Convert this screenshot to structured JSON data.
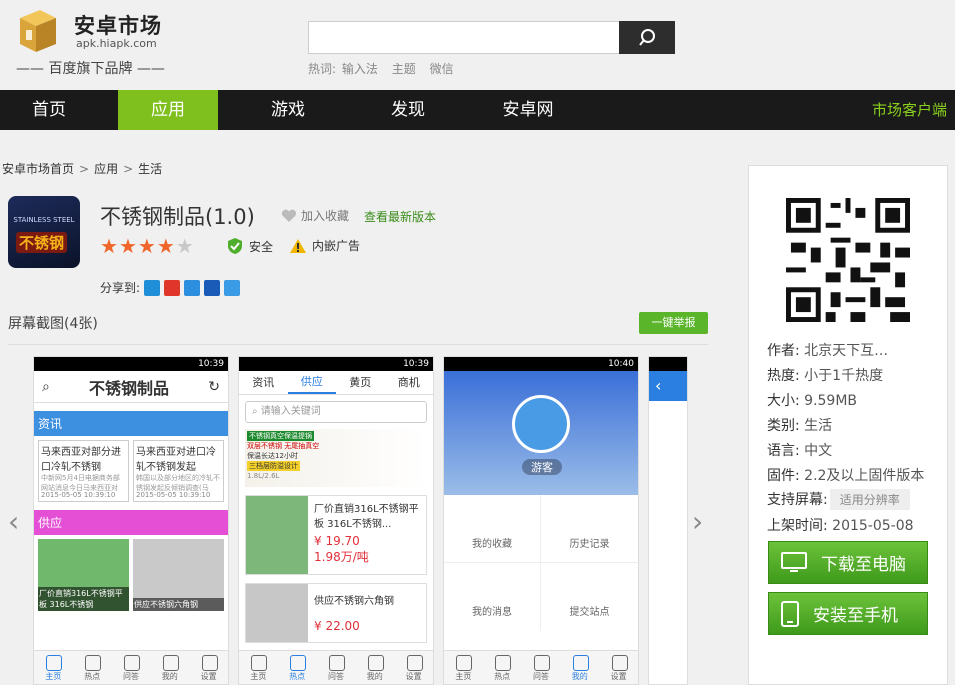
{
  "header": {
    "logo_title": "安卓市场",
    "logo_url": "apk.hiapk.com",
    "logo_sub": "—— 百度旗下品牌 ——",
    "hot_label": "热词:",
    "hot_words": [
      "输入法",
      "主题",
      "微信"
    ]
  },
  "nav": {
    "items": [
      "首页",
      "应用",
      "游戏",
      "发现",
      "安卓网"
    ],
    "active": "应用",
    "right": "市场客户端"
  },
  "breadcrumb": [
    "安卓市场首页",
    "应用",
    "生活"
  ],
  "app": {
    "name": "不锈钢制品(1.0)",
    "fav_label": "加入收藏",
    "latest_label": "查看最新版本",
    "rating": 4,
    "rating_max": 5,
    "safe_label": "安全",
    "ads_label": "内嵌广告",
    "share_label": "分享到:",
    "icon_text_top": "STAINLESS STEEL",
    "icon_text_main": "不锈钢"
  },
  "screenshots": {
    "title": "屏幕截图(4张)",
    "report_label": "一键举报",
    "shot1": {
      "time": "10:39",
      "title": "不锈钢制品",
      "section1": "资讯",
      "news": [
        {
          "title": "马来西亚对部分进口冷轧不锈钢",
          "desc": "中新网5月4日电据商务部网站消息今日马来西亚对",
          "date": "2015-05-05 10:39:10"
        },
        {
          "title": "马来西亚对进口冷轧不锈钢发起",
          "desc": "韩国以及部分地区的冷轧不锈钢发起反倾销调查(马",
          "date": "2015-05-05 10:39:10"
        }
      ],
      "section2": "供应",
      "supply": [
        "厂价直销316L不锈钢平板 316L不锈钢",
        "供应不锈钢六角钢"
      ],
      "tabs": [
        "主页",
        "热点",
        "问答",
        "我的",
        "设置"
      ]
    },
    "shot2": {
      "time": "10:39",
      "tabs": [
        "资讯",
        "供应",
        "黄页",
        "商机"
      ],
      "active_tab": "供应",
      "search_placeholder": "请输入关键词",
      "banner_lines": [
        "不锈钢真空保温提锅",
        "双层不锈钢 无尾抽真空",
        "保温长达12小时",
        "三档层防溢设计",
        "1.8L/2.6L"
      ],
      "items": [
        {
          "title": "厂价直销316L不锈钢平板 316L不锈钢...",
          "price": "¥ 19.70",
          "unit": "1.98万/吨"
        },
        {
          "title": "供应不锈钢六角钢",
          "price": "¥ 22.00",
          "unit": ""
        }
      ],
      "bottom_tabs": [
        "主页",
        "热点",
        "问答",
        "我的",
        "设置"
      ]
    },
    "shot3": {
      "time": "10:40",
      "guest_label": "游客",
      "grid": [
        "我的收藏",
        "历史记录",
        "我的消息",
        "提交站点"
      ],
      "bottom_tabs": [
        "主页",
        "热点",
        "问答",
        "我的",
        "设置"
      ]
    }
  },
  "sidebar": {
    "fields": [
      {
        "label": "作者:",
        "value": "北京天下互…"
      },
      {
        "label": "热度:",
        "value": "小于1千热度"
      },
      {
        "label": "大小:",
        "value": "9.59MB"
      },
      {
        "label": "类别:",
        "value": "生活"
      },
      {
        "label": "语言:",
        "value": "中文"
      },
      {
        "label": "固件:",
        "value": "2.2及以上固件版本"
      },
      {
        "label": "支持屏幕:",
        "value": "适用分辨率"
      },
      {
        "label": "上架时间:",
        "value": "2015-05-08"
      }
    ],
    "download_pc": "下载至电脑",
    "install_phone": "安装至手机"
  },
  "colors": {
    "accent": "#7fbf1e",
    "nav_bg": "#1a1a1a",
    "star": "#f0652a",
    "blue": "#2b7fe0"
  }
}
